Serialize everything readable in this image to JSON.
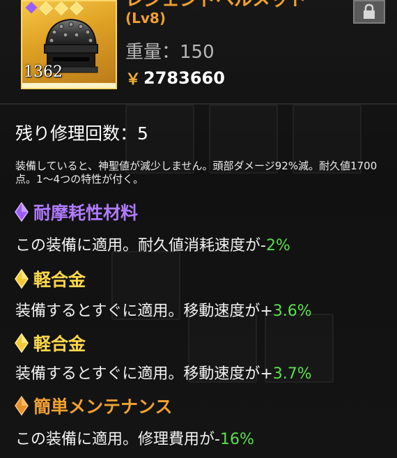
{
  "item": {
    "name": "レジェンドヘルメット",
    "level": "(Lv8)",
    "weight_label": "重量：",
    "weight_value": "150",
    "price_symbol": "￥",
    "price_value": "2783660",
    "count": "1362",
    "gems": [
      "purple",
      "yellow",
      "yellow",
      "yellow"
    ],
    "icon": "helmet-icon"
  },
  "repair": {
    "label": "残り修理回数：",
    "value": "5"
  },
  "description": "装備していると、神聖値が減少しません。頭部ダメージ92%減。耐久値1700点。1～4つの特性が付く。",
  "traits": [
    {
      "name": "耐摩耗性材料",
      "color": "#b07aff",
      "gem_color": "#9b5cff",
      "text": "この装備に適用。耐久値消耗速度が",
      "sign": "-",
      "value": "2%"
    },
    {
      "name": "軽合金",
      "color": "#ffd84a",
      "gem_color": "#ffd84a",
      "text": "装備するとすぐに適用。移動速度が",
      "sign": "+",
      "value": "3.6%"
    },
    {
      "name": "軽合金",
      "color": "#ffd84a",
      "gem_color": "#ffd84a",
      "text": "装備するとすぐに適用。移動速度が",
      "sign": "+",
      "value": "3.7%"
    },
    {
      "name": "簡単メンテナンス",
      "color": "#f0a030",
      "gem_color": "#f0a030",
      "text": "この装備に適用。修理費用が",
      "sign": "-",
      "value": "16%"
    }
  ],
  "colors": {
    "title": "#f0a030",
    "positive": "#58e04a",
    "background": "#121212"
  }
}
